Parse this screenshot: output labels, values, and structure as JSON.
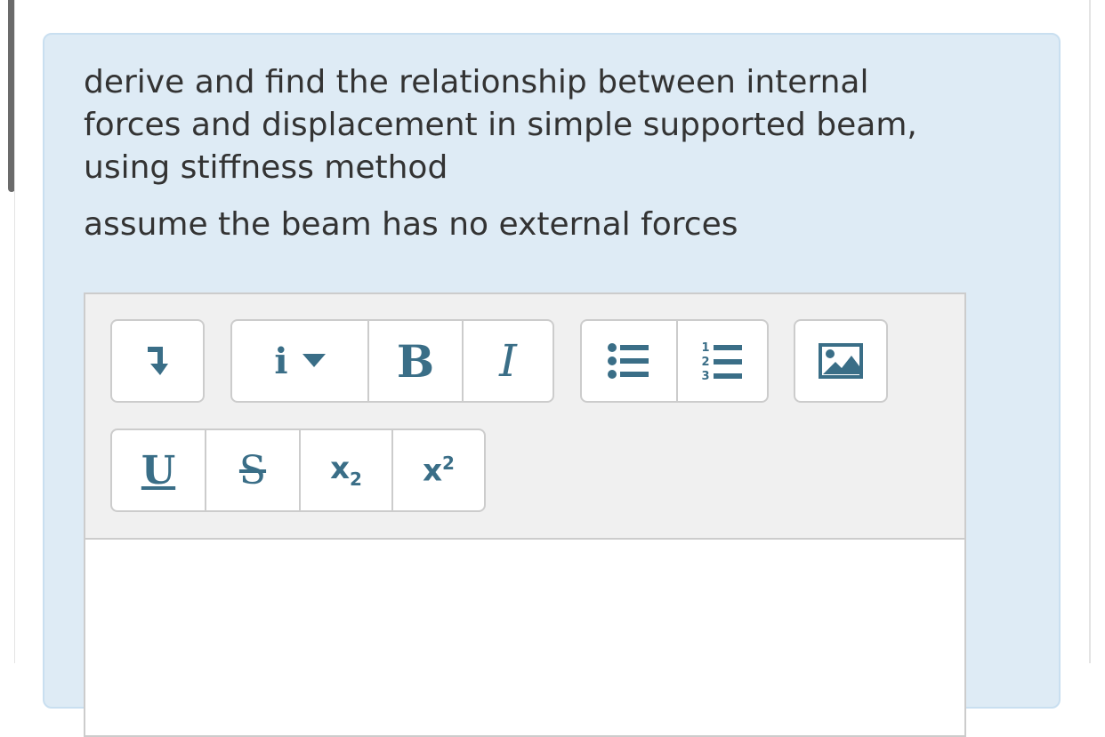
{
  "question": {
    "prompt": "derive and find the relationship between internal forces and displacement in simple supported beam, using stiffness method",
    "note": "assume the beam has no external forces"
  },
  "editor": {
    "toolbar": {
      "bold_label": "B",
      "italic_label": "I",
      "underline_label": "U",
      "strikethrough_label": "S",
      "subscript_base": "x",
      "subscript_mark": "2",
      "superscript_base": "x",
      "superscript_mark": "2",
      "paragraph_format_label": "i",
      "icons": [
        "indent-arrow-icon",
        "info-dropdown-icon",
        "bullet-list-icon",
        "numbered-list-icon",
        "image-icon"
      ]
    },
    "content": ""
  },
  "colors": {
    "panel_background": "#deebf5",
    "toolbar_background": "#f0f0f0",
    "icon_color": "#3a6e87"
  }
}
